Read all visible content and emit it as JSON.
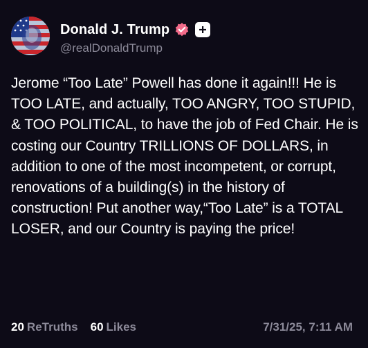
{
  "author": {
    "display_name": "Donald J. Trump",
    "handle": "@realDonaldTrump",
    "avatar_icon": "flag-portrait-avatar",
    "verified_icon": "verified-badge-icon",
    "plus_icon": "plus-icon"
  },
  "post": {
    "text": "Jerome “Too Late” Powell has done it again!!! He is TOO LATE, and actually, TOO ANGRY, TOO STUPID, & TOO POLITICAL, to have the job of Fed Chair. He is costing our Country TRILLIONS OF DOLLARS, in addition to one of the most incompetent, or corrupt, renovations of a building(s) in the history of construction! Put another way,“Too Late” is a TOTAL LOSER, and our Country is paying the price!"
  },
  "footer": {
    "retruths_count": "20",
    "retruths_label": "ReTruths",
    "likes_count": "60",
    "likes_label": "Likes",
    "timestamp": "7/31/25, 7:11 AM"
  },
  "colors": {
    "background": "#0d0b17",
    "text": "#ffffff",
    "muted": "#8c8a99",
    "verified": "#f26b8a"
  }
}
